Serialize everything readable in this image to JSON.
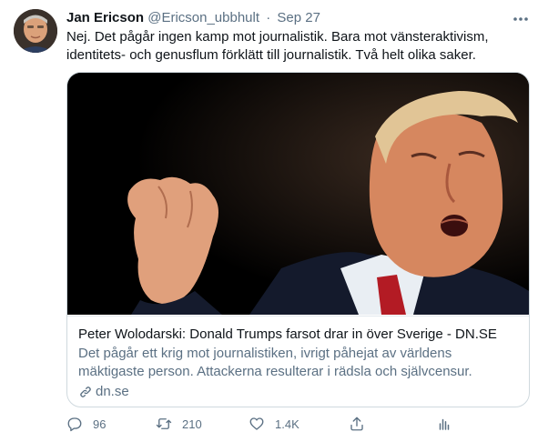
{
  "tweet": {
    "author_name": "Jan Ericson",
    "handle": "@Ericson_ubbhult",
    "separator": "·",
    "date": "Sep 27",
    "text": "Nej. Det pågår ingen kamp mot journalistik. Bara mot vänsteraktivism, identitets- och genusflum förklätt till journalistik. Två helt olika saker."
  },
  "card": {
    "title": "Peter Wolodarski: Donald Trumps farsot drar in över Sverige - DN.SE",
    "description": "Det pågår ett krig mot journalistiken, ivrigt påhejat av världens mäktigaste person. Attackerna resulterar i rädsla och självcensur.",
    "domain": "dn.se"
  },
  "actions": {
    "reply_count": "96",
    "retweet_count": "210",
    "like_count": "1.4K"
  },
  "icons": {
    "more": "more-horizontal-icon",
    "link": "link-icon",
    "reply": "reply-icon",
    "retweet": "retweet-icon",
    "like": "heart-icon",
    "share": "share-icon",
    "analytics": "analytics-icon"
  },
  "colors": {
    "text": "#0f1419",
    "secondary": "#5b7083",
    "border": "#cfd9de"
  }
}
